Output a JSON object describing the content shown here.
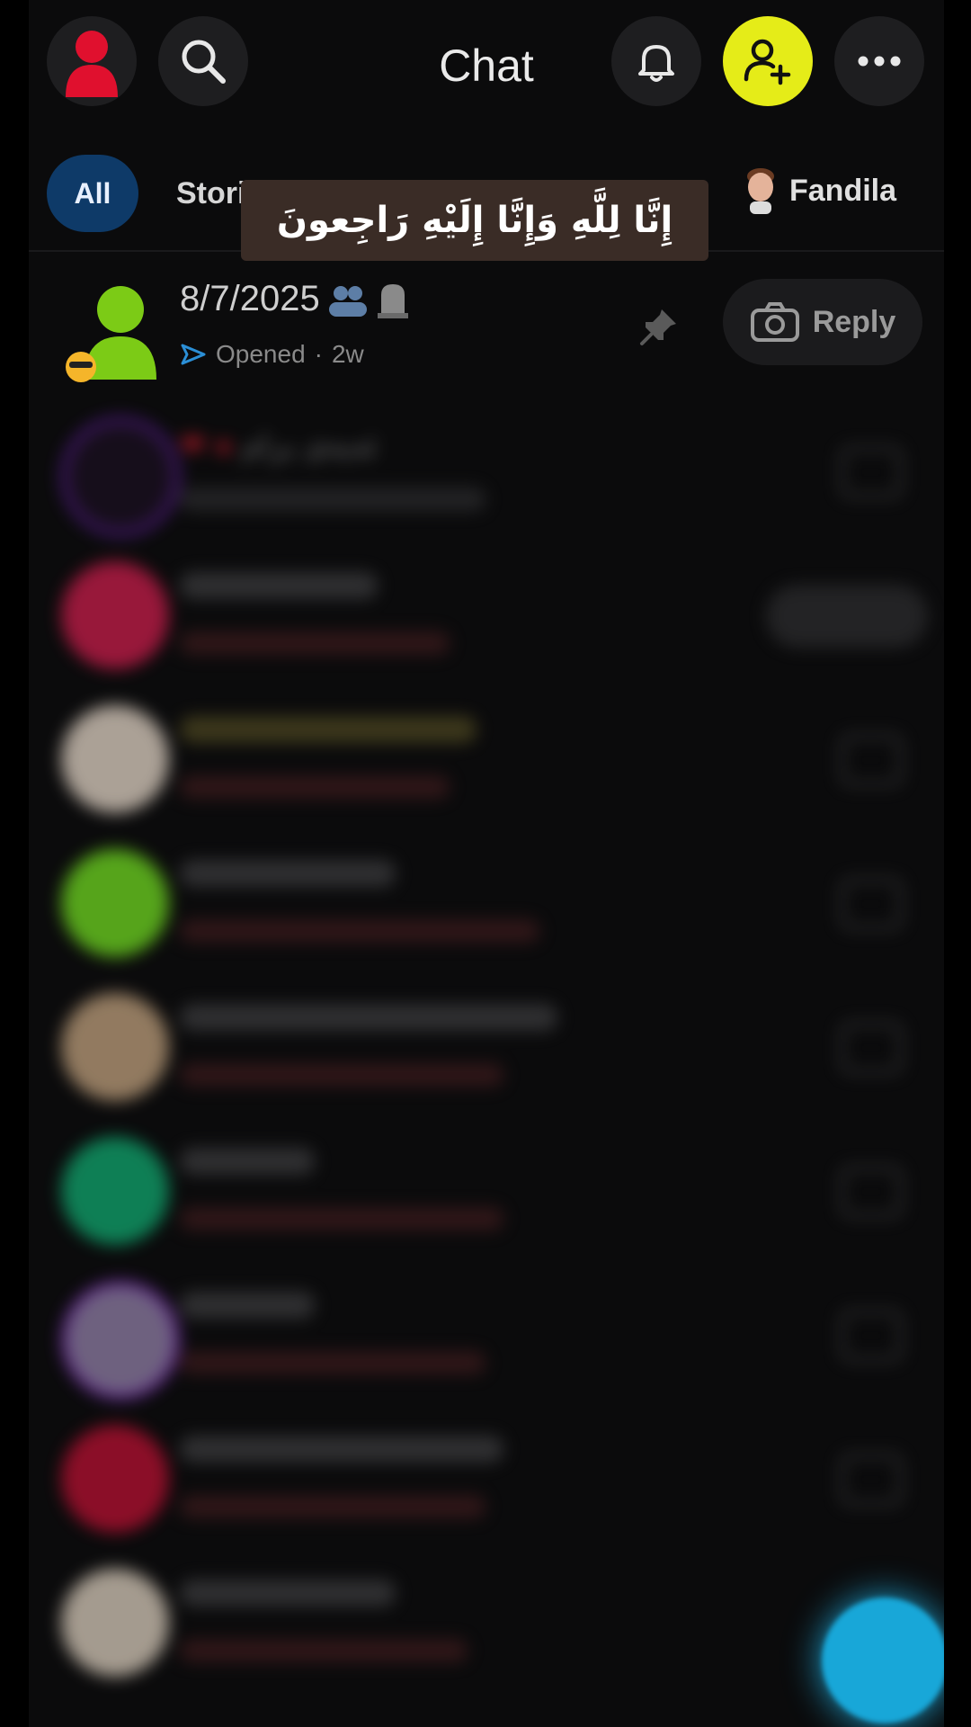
{
  "header": {
    "title": "Chat"
  },
  "tabs": {
    "all": "All",
    "stories": "Stori",
    "fandila": "Fandila"
  },
  "caption": "إِنَّا لِلَّهِ وَإِنَّا إِلَيْهِ رَاجِعونَ",
  "chats": [
    {
      "name": "8/7/2025",
      "status": "Opened",
      "time": "2w",
      "action": "Reply"
    },
    {
      "name": "ئەیەی برام"
    }
  ],
  "colors": {
    "add_friend": "#e5ec18",
    "tab_all_bg": "#0e3a68",
    "fab": "#18a7d8",
    "opened_arrow": "#2b8fd6"
  },
  "icons": [
    "avatar-icon",
    "search-icon",
    "bell-icon",
    "add-friend-icon",
    "more-icon",
    "pin-icon",
    "camera-icon"
  ]
}
